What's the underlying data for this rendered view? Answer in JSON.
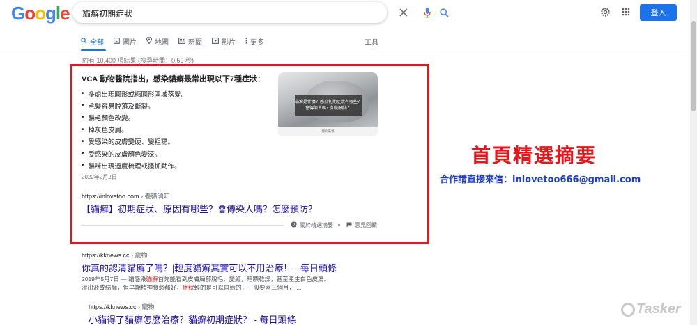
{
  "logo": {
    "letters": [
      "G",
      "o",
      "o",
      "g",
      "l",
      "e"
    ],
    "colors": [
      "#4285f4",
      "#ea4335",
      "#fbbc05",
      "#4285f4",
      "#34a853",
      "#ea4335"
    ]
  },
  "search": {
    "query": "貓癬初期症狀"
  },
  "header": {
    "signin_label": "登入"
  },
  "tabs": [
    {
      "label": "全部",
      "icon": "search-icon",
      "active": true
    },
    {
      "label": "圖片",
      "icon": "image-icon"
    },
    {
      "label": "地圖",
      "icon": "map-pin-icon"
    },
    {
      "label": "新聞",
      "icon": "news-icon"
    },
    {
      "label": "影片",
      "icon": "video-icon"
    },
    {
      "label": "更多",
      "icon": "more-icon"
    }
  ],
  "tools_label": "工具",
  "result_stats": "約有 10,400 項結果 (搜尋時間：0.59 秒)",
  "snippet": {
    "title": "VCA 動物醫院指出，感染貓癬最常出現以下7種症狀：",
    "items": [
      "多處出現圓形或橢圓形區域落髮。",
      "毛髮容易脫落及斷裂。",
      "貓毛顏色改變。",
      "掉灰色皮屑。",
      "受感染的皮膚變硬、變粗糙。",
      "受感染的皮膚顏色變深。",
      "貓咪出現過度梳理或搔抓動作。"
    ],
    "date": "2022年2月2日",
    "source_url": "https://inlovetoo.com",
    "source_crumb": "› 養貓須知",
    "link_title": "【貓癬】初期症狀、原因有哪些？會傳染人嗎？怎麼預防？",
    "about_label": "關於精選摘要",
    "feedback_label": "意見回饋",
    "image_caption_1": "貓癬是什麼？感染初期症狀有哪些？",
    "image_caption_2": "會傳染人嗎？如何預防？",
    "image_footer": "圖片來源"
  },
  "promo": {
    "title": "首頁精選摘要",
    "contact": "合作請直接來信：inlovetoo666@gmail.com"
  },
  "results": [
    {
      "source_url": "https://kknews.cc",
      "source_crumb": "› 寵物",
      "title": "你真的認清貓癬了嗎？|輕度貓癬其實可以不用治療！ - 每日頭條",
      "desc_1a": "2019年5月7日 — 貓感染",
      "desc_1hl": "貓癬",
      "desc_1b": "首先能看到皮膚局部脫毛、變紅，暗顆乾燥，甚至產生白色皮屑。",
      "desc_2a": "滲出液或結痂，但早期精神食慾都好，",
      "desc_2hl": "症狀",
      "desc_2b": "輕的是可以自癒的，一般要兩三個月， ..."
    },
    {
      "source_url": "https://kknews.cc",
      "source_crumb": "› 寵物",
      "title": "小貓得了貓癬怎麼治療？貓癬初期症狀？ - 每日頭條"
    }
  ],
  "watermark": "Tasker"
}
